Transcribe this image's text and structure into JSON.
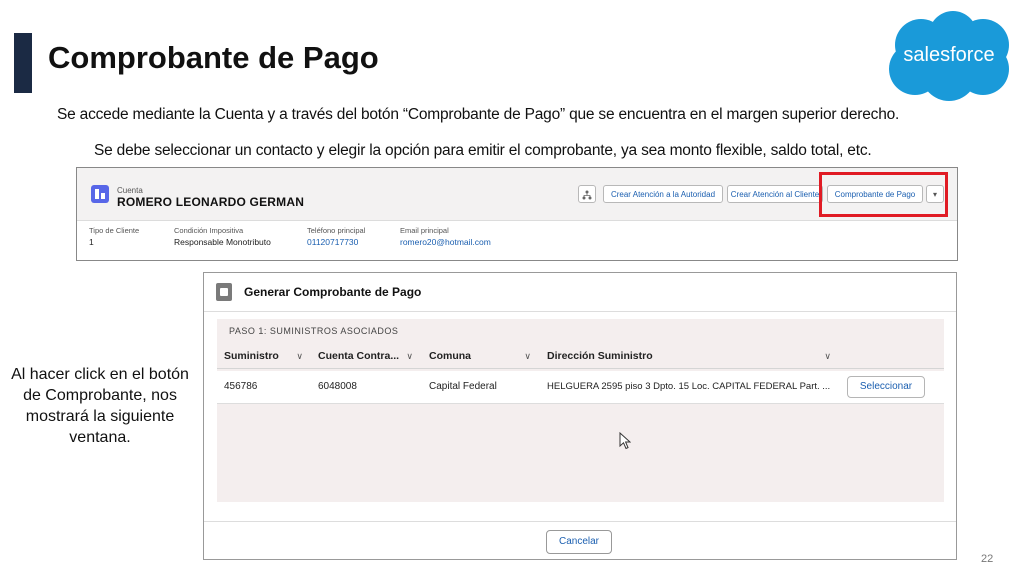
{
  "slide": {
    "title": "Comprobante de Pago",
    "logo_text": "salesforce",
    "desc_line1": "Se accede mediante la Cuenta y a través del botón “Comprobante de Pago” que se encuentra en el margen superior derecho.",
    "desc_line2": "Se debe seleccionar un contacto y elegir la opción para emitir el comprobante, ya sea monto flexible, saldo total, etc.",
    "side_note": "Al hacer click en el botón de Comprobante, nos mostrará la siguiente ventana.",
    "page_number": "22"
  },
  "record": {
    "object_label": "Cuenta",
    "name": "ROMERO LEONARDO GERMAN",
    "buttons": {
      "hierarchy_icon": "hierarchy-icon",
      "btn1": "Crear Atención a la Autoridad",
      "btn2": "Crear Atención al Cliente",
      "btn3": "Comprobante de Pago",
      "more_icon": "chevron-down-icon"
    },
    "fields": [
      {
        "label": "Tipo de Cliente",
        "value": "1"
      },
      {
        "label": "Condición Impositiva",
        "value": "Responsable Monotributo"
      },
      {
        "label": "Teléfono principal",
        "value": "01120717730"
      },
      {
        "label": "Email principal",
        "value": "romero20@hotmail.com"
      }
    ]
  },
  "modal": {
    "title": "Generar Comprobante de Pago",
    "step_label": "PASO 1: SUMINISTROS ASOCIADOS",
    "columns": [
      "Suministro",
      "Cuenta Contra...",
      "Comuna",
      "Dirección Suministro"
    ],
    "row": {
      "suministro": "456786",
      "cuenta": "6048008",
      "comuna": "Capital Federal",
      "direccion": "HELGUERA 2595 piso 3 Dpto. 15 Loc. CAPITAL FEDERAL Part. ...",
      "action": "Seleccionar"
    },
    "cancel": "Cancelar"
  },
  "colors": {
    "accent": "#1b2a44",
    "salesforce_blue": "#1a9ad9",
    "highlight_red": "#e01b24",
    "link_blue": "#1b5fb0"
  }
}
